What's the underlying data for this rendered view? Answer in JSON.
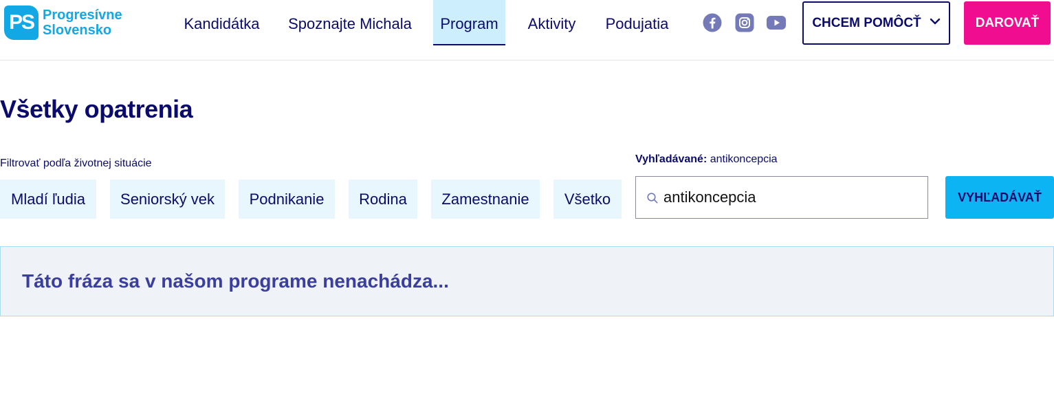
{
  "brand": {
    "logo_mark": "PS",
    "name_line1": "Progresívne",
    "name_line2": "Slovensko",
    "color": "#12a8e6"
  },
  "nav": {
    "items": [
      {
        "label": "Kandidátka",
        "active": false
      },
      {
        "label": "Spoznajte Michala",
        "active": false
      },
      {
        "label": "Program",
        "active": true
      },
      {
        "label": "Aktivity",
        "active": false
      },
      {
        "label": "Podujatia",
        "active": false
      }
    ]
  },
  "social": {
    "icons": [
      "facebook-icon",
      "instagram-icon",
      "youtube-icon"
    ],
    "color": "#7479b8"
  },
  "header_actions": {
    "help_label": "CHCEM POMÔCŤ",
    "donate_label": "DAROVAŤ",
    "donate_color": "#f00d8f"
  },
  "main": {
    "title": "Všetky opatrenia",
    "filter_label": "Filtrovať podľa životnej situácie",
    "chips": [
      "Mladí ľudia",
      "Seniorský vek",
      "Podnikanie",
      "Rodina",
      "Zamestnanie",
      "Všetko"
    ]
  },
  "search": {
    "label_prefix": "Vyhľadávané:",
    "label_value": "antikoncepcia",
    "value": "antikoncepcia",
    "button_label": "VYHĽADÁVAŤ",
    "button_color": "#0cb4f4"
  },
  "result": {
    "message": "Táto fráza sa v našom programe nenachádza..."
  }
}
